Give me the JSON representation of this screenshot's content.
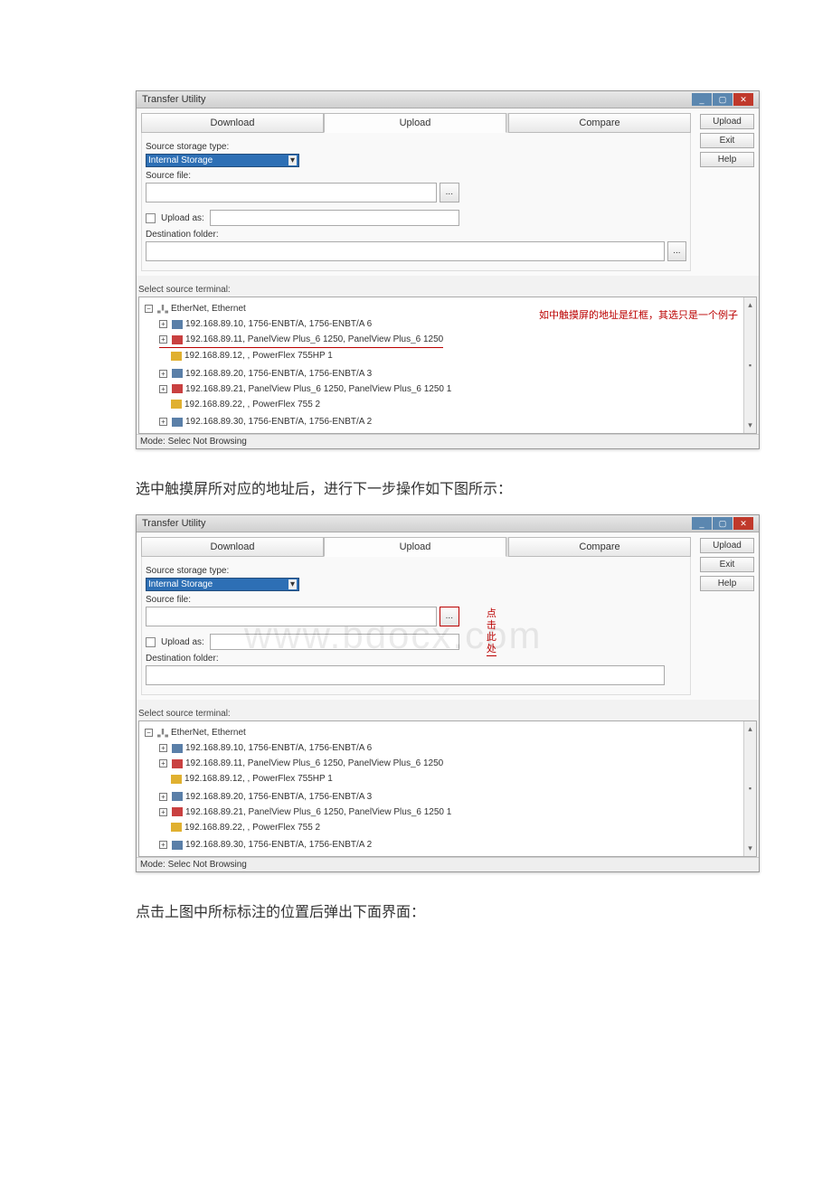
{
  "watermark": "www.bdocx.com",
  "doc_text_1": "选中触摸屏所对应的地址后，进行下一步操作如下图所示：",
  "doc_text_2": "点击上图中所标标注的位置后弹出下面界面：",
  "win1": {
    "title": "Transfer Utility",
    "tabs": {
      "download": "Download",
      "upload": "Upload",
      "compare": "Compare"
    },
    "side": {
      "upload": "Upload",
      "exit": "Exit",
      "help": "Help"
    },
    "form": {
      "storage_type_label": "Source storage type:",
      "storage_type_value": "Internal Storage",
      "source_file_label": "Source file:",
      "browse": "...",
      "upload_as_label": "Upload as:",
      "dest_label": "Destination folder:"
    },
    "terminal_label": "Select source terminal:",
    "annotation": "如中触摸屏的地址是红框，其选只是一个例子",
    "tree": {
      "root": "EtherNet, Ethernet",
      "n1": "192.168.89.10, 1756-ENBT/A, 1756-ENBT/A 6",
      "n2": "192.168.89.11, PanelView Plus_6 1250, PanelView Plus_6 1250",
      "n3": "192.168.89.12, , PowerFlex 755HP 1",
      "n4": "192.168.89.20, 1756-ENBT/A, 1756-ENBT/A 3",
      "n5": "192.168.89.21, PanelView Plus_6 1250, PanelView Plus_6 1250 1",
      "n6": "192.168.89.22, , PowerFlex 755 2",
      "n7": "192.168.89.30, 1756-ENBT/A, 1756-ENBT/A 2"
    },
    "status": "Mode: Selec Not Browsing"
  },
  "win2": {
    "title": "Transfer Utility",
    "tabs": {
      "download": "Download",
      "upload": "Upload",
      "compare": "Compare"
    },
    "side": {
      "upload": "Upload",
      "exit": "Exit",
      "help": "Help"
    },
    "form": {
      "storage_type_label": "Source storage type:",
      "storage_type_value": "Internal Storage",
      "source_file_label": "Source file:",
      "browse": "...",
      "upload_as_label": "Upload as:",
      "dest_label": "Destination folder:"
    },
    "annotation2": "点击此处",
    "terminal_label": "Select source terminal:",
    "tree": {
      "root": "EtherNet, Ethernet",
      "n1": "192.168.89.10, 1756-ENBT/A, 1756-ENBT/A 6",
      "n2": "192.168.89.11, PanelView Plus_6 1250, PanelView Plus_6 1250",
      "n3": "192.168.89.12, , PowerFlex 755HP 1",
      "n4": "192.168.89.20, 1756-ENBT/A, 1756-ENBT/A 3",
      "n5": "192.168.89.21, PanelView Plus_6 1250, PanelView Plus_6 1250 1",
      "n6": "192.168.89.22, , PowerFlex 755 2",
      "n7": "192.168.89.30, 1756-ENBT/A, 1756-ENBT/A 2"
    },
    "status": "Mode: Selec Not Browsing"
  },
  "glyph": {
    "minus": "−",
    "plus": "+",
    "dd": "▾",
    "up": "▴",
    "dn": "▾",
    "mid": "▪"
  }
}
